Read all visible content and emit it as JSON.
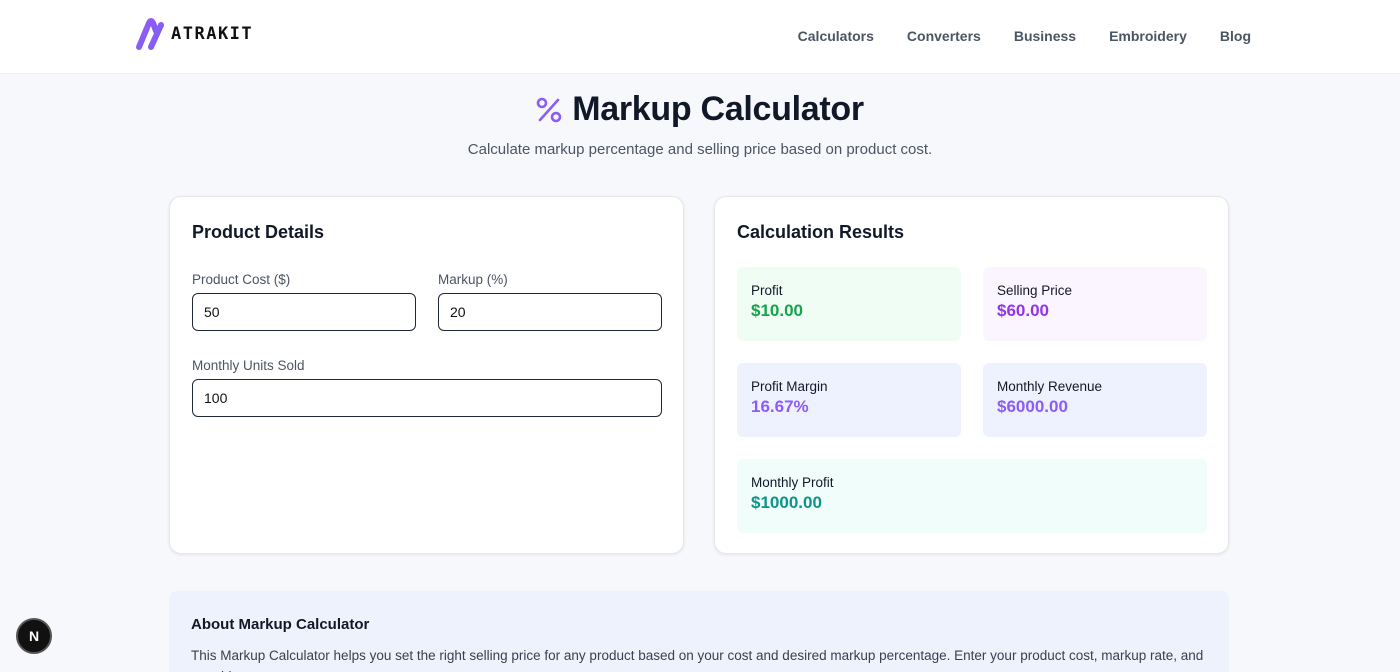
{
  "header": {
    "logo_text": "ATRAKIT",
    "nav": [
      "Calculators",
      "Converters",
      "Business",
      "Embroidery",
      "Blog"
    ]
  },
  "page": {
    "title_icon": "percent-icon",
    "title": "Markup Calculator",
    "subtitle": "Calculate markup percentage and selling price based on product cost."
  },
  "product": {
    "title": "Product Details",
    "cost_label": "Product Cost ($)",
    "cost_value": "50",
    "markup_label": "Markup (%)",
    "markup_value": "20",
    "units_label": "Monthly Units Sold",
    "units_value": "100"
  },
  "results": {
    "title": "Calculation Results",
    "items": [
      {
        "label": "Profit",
        "value": "$10.00",
        "bg": "#f0fdf4",
        "color": "#16a34a"
      },
      {
        "label": "Selling Price",
        "value": "$60.00",
        "bg": "#faf5ff",
        "color": "#9333ea"
      },
      {
        "label": "Profit Margin",
        "value": "16.67%",
        "bg": "#eef2ff",
        "color": "#8b5cf6"
      },
      {
        "label": "Monthly Revenue",
        "value": "$6000.00",
        "bg": "#eef2ff",
        "color": "#8b5cf6"
      },
      {
        "label": "Monthly Profit",
        "value": "$1000.00",
        "bg": "#f0fdfa",
        "color": "#0d9488"
      }
    ]
  },
  "about": {
    "title": "About Markup Calculator",
    "text": "This Markup Calculator helps you set the right selling price for any product based on your cost and desired markup percentage. Enter your product cost, markup rate, and monthly"
  },
  "fab_label": "N",
  "colors": {
    "accent": "#8b5cf6"
  }
}
